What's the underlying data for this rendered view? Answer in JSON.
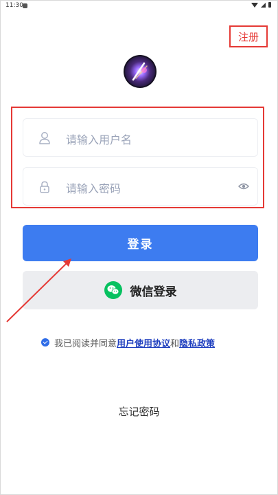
{
  "status_bar": {
    "time": "11:30"
  },
  "header": {
    "register_label": "注册"
  },
  "login_form": {
    "username_placeholder": "请输入用户名",
    "password_placeholder": "请输入密码"
  },
  "buttons": {
    "login_label": "登录",
    "wechat_login_label": "微信登录"
  },
  "agreement": {
    "prefix": "我已阅读并同意",
    "user_agreement_link": "用户使用协议",
    "conjunction": "和",
    "privacy_policy_link": "隐私政策",
    "checked": true
  },
  "footer": {
    "forgot_password_label": "忘记密码"
  },
  "colors": {
    "primary": "#3d7cf0",
    "annotation_red": "#e53935",
    "wechat_green": "#07c160",
    "link": "#1f3fbf"
  },
  "icons": [
    "user-icon",
    "lock-icon",
    "eye-icon",
    "wechat-icon",
    "check-icon"
  ]
}
